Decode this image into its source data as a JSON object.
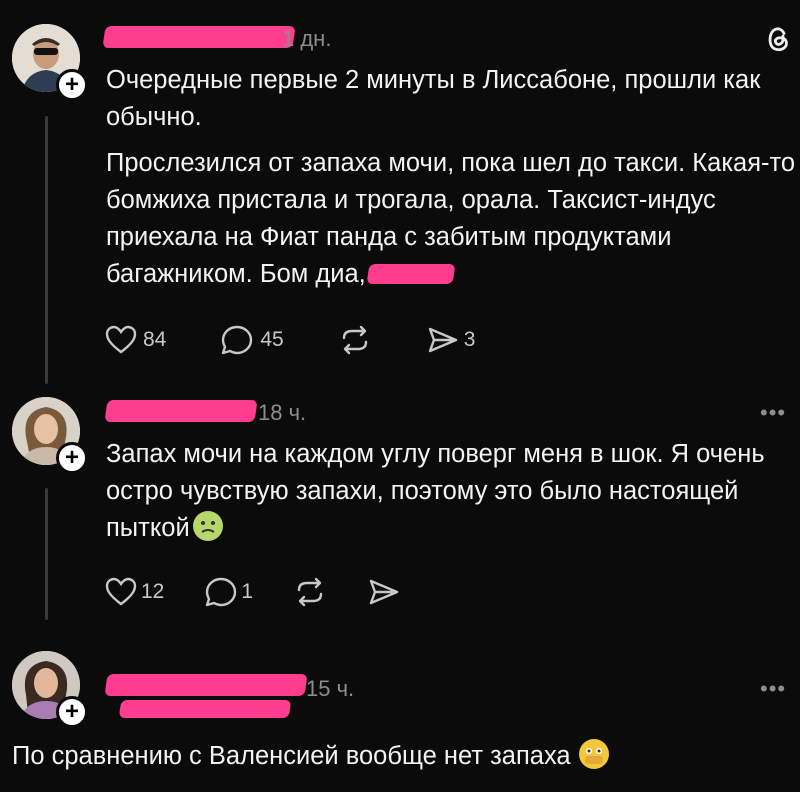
{
  "app": {
    "logo": "threads-logo"
  },
  "posts": [
    {
      "time": "1 дн.",
      "paragraphs": [
        "Очередные первые 2 минуты в Лиссабоне, прошли как обычно.",
        "Прослезился от запаха мочи, пока шел до такси. Какая-то бомжиха пристала и трогала, орала. Таксист-индус приехала на Фиат панда с забитым продуктами багажником. Бом диа,"
      ],
      "likes": "84",
      "replies": "45",
      "shares": "3"
    },
    {
      "time": "18 ч.",
      "text": "Запах мочи на каждом углу поверг меня в шок. Я очень остро чувствую запахи, поэтому это было настоящей пыткой",
      "emoji": "nauseated-face",
      "likes": "12",
      "replies": "1",
      "more": "•••"
    },
    {
      "time": "15 ч.",
      "text": "По сравнению с Валенсией вообще нет запаха",
      "emoji": "face-with-open-eyes-and-hand-over-mouth",
      "more": "•••"
    }
  ],
  "colors": {
    "redaction": "#ff3d8f",
    "background": "#0b0b0b"
  }
}
